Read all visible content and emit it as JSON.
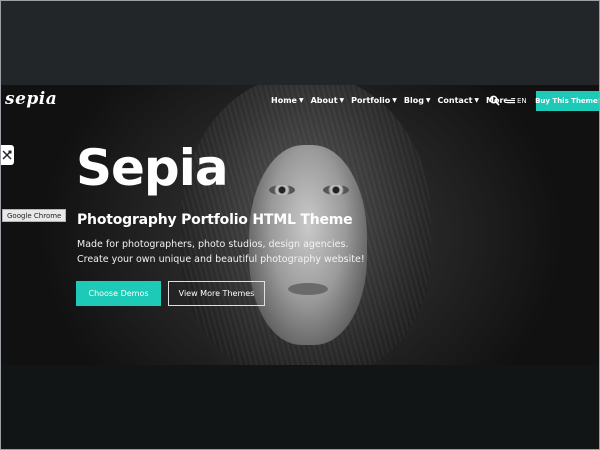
{
  "header": {
    "logo": "sepia",
    "nav": [
      {
        "label": "Home"
      },
      {
        "label": "About"
      },
      {
        "label": "Portfolio"
      },
      {
        "label": "Blog"
      },
      {
        "label": "Contact"
      },
      {
        "label": "More"
      }
    ],
    "search_icon": "search-icon",
    "language": "EN",
    "buy_label": "Buy This Theme!"
  },
  "side": {
    "tools_icon": "wrench-icon",
    "tooltip": "Google Chrome"
  },
  "hero": {
    "title": "Sepia",
    "subtitle": "Photography Portfolio HTML Theme",
    "desc_line1": "Made for photographers, photo studios, design agencies.",
    "desc_line2": "Create your own unique and beautiful photography website!",
    "primary_button": "Choose Demos",
    "secondary_button": "View More Themes"
  },
  "colors": {
    "accent": "#1dc9b7",
    "background": "#1c1e21"
  }
}
